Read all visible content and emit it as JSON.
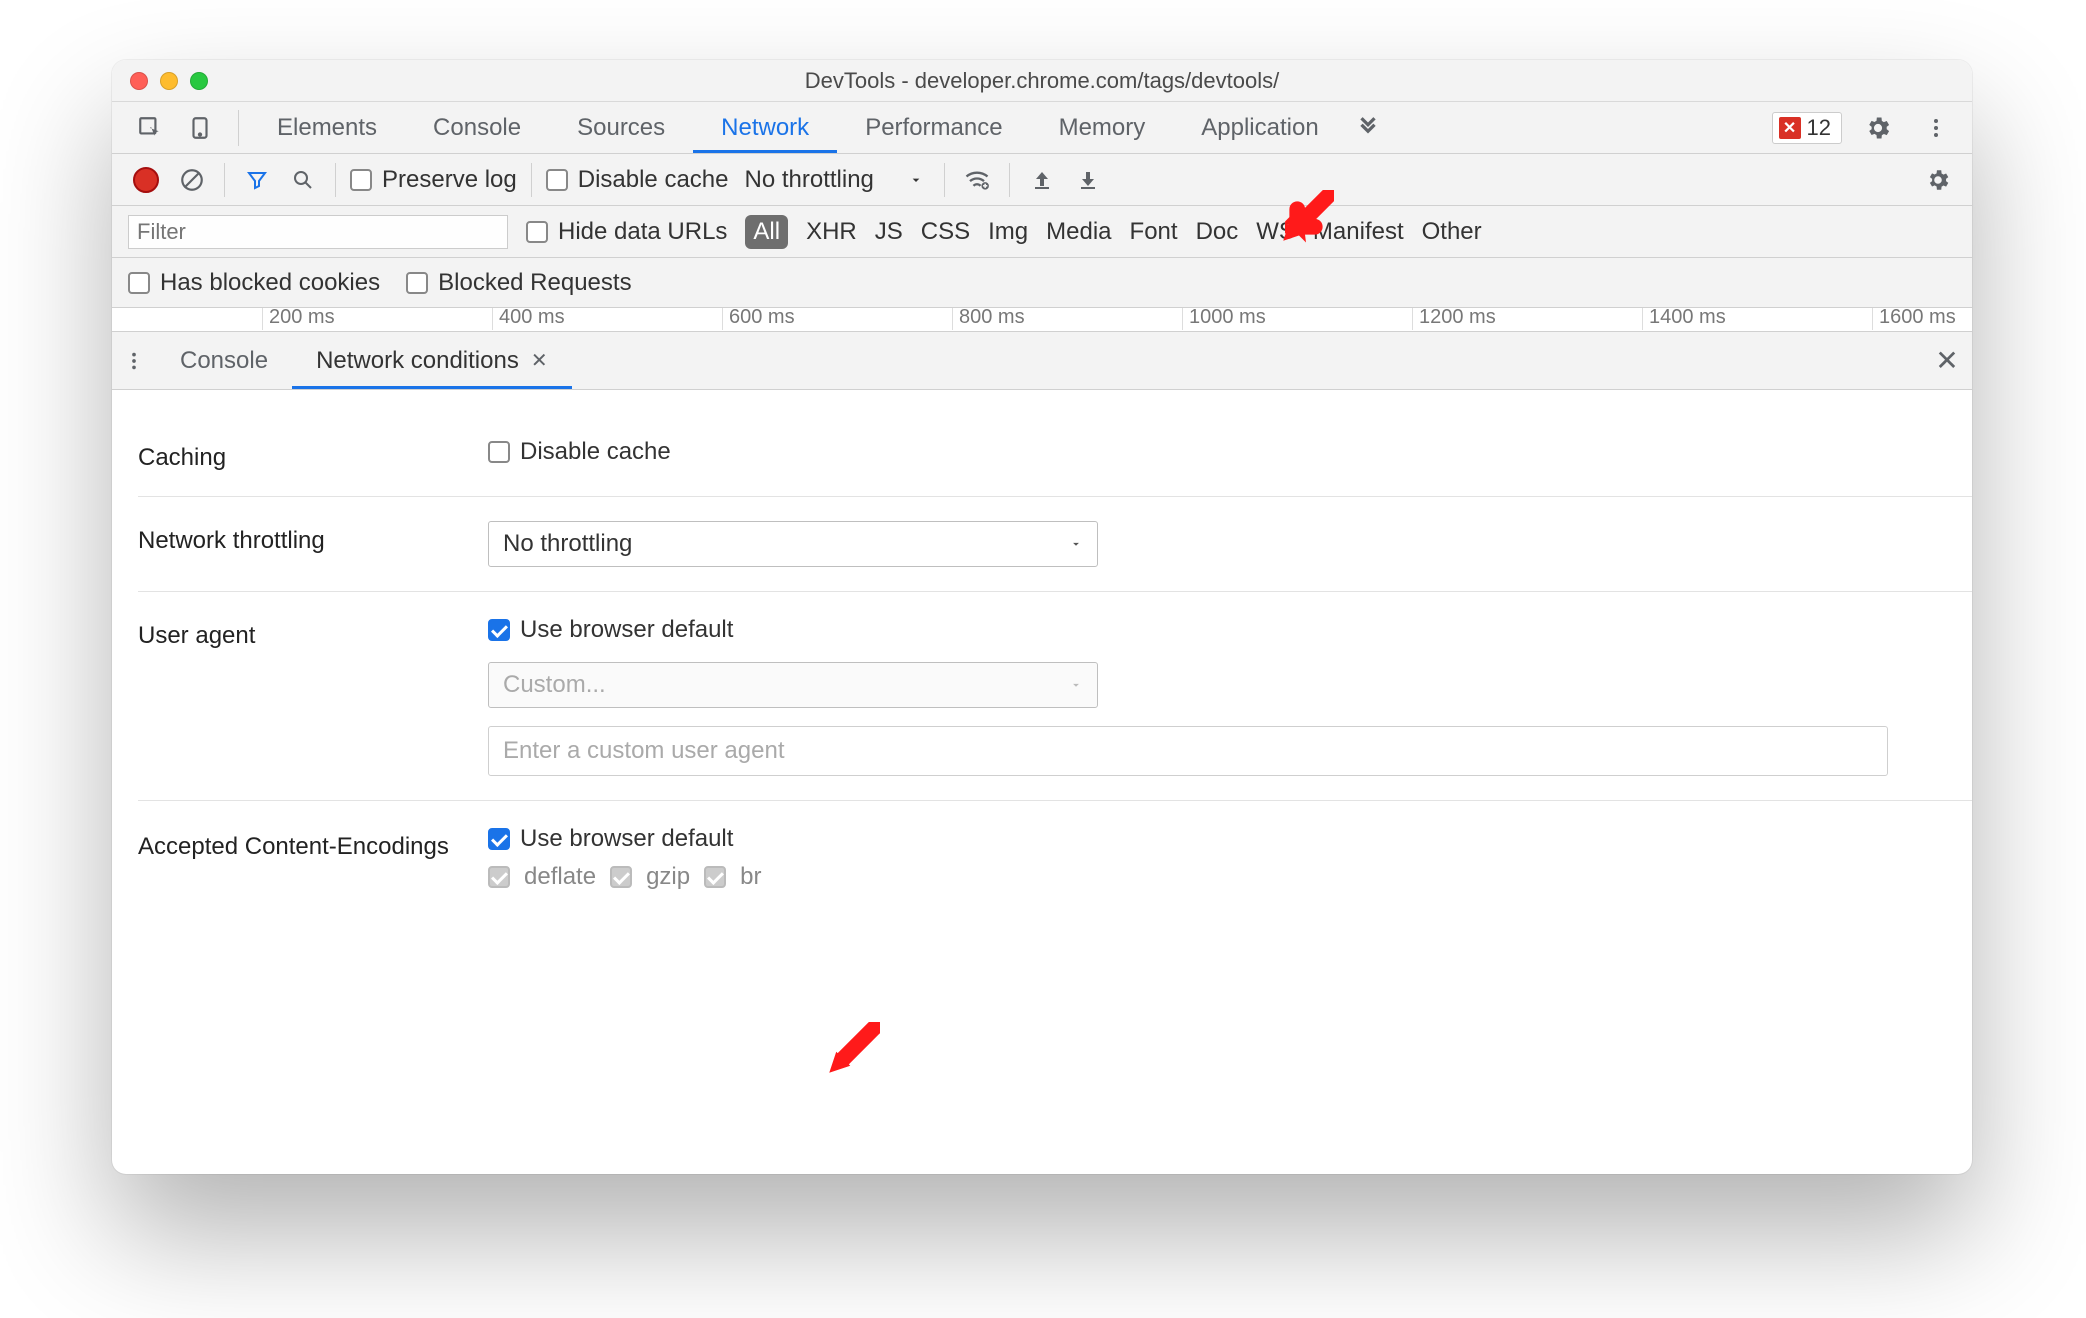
{
  "window": {
    "title": "DevTools - developer.chrome.com/tags/devtools/"
  },
  "mainTabs": {
    "items": [
      "Elements",
      "Console",
      "Sources",
      "Network",
      "Performance",
      "Memory",
      "Application"
    ],
    "activeIndex": 3
  },
  "errorBadge": {
    "count": "12",
    "icon_glyph": "✕"
  },
  "netToolbar": {
    "preserve_log": "Preserve log",
    "disable_cache": "Disable cache",
    "throttling": "No throttling"
  },
  "filterRow": {
    "placeholder": "Filter",
    "hide_data_urls": "Hide data URLs",
    "types": [
      "All",
      "XHR",
      "JS",
      "CSS",
      "Img",
      "Media",
      "Font",
      "Doc",
      "WS",
      "Manifest",
      "Other"
    ],
    "activeType": 0
  },
  "blockedRow": {
    "blocked_cookies": "Has blocked cookies",
    "blocked_requests": "Blocked Requests"
  },
  "timeline": {
    "ticks": [
      "200 ms",
      "400 ms",
      "600 ms",
      "800 ms",
      "1000 ms",
      "1200 ms",
      "1400 ms",
      "1600 ms"
    ]
  },
  "drawer": {
    "tabs": [
      {
        "label": "Console",
        "active": false
      },
      {
        "label": "Network conditions",
        "active": true
      }
    ]
  },
  "panel": {
    "caching": {
      "label": "Caching",
      "disable_cache": "Disable cache"
    },
    "throttling": {
      "label": "Network throttling",
      "value": "No throttling"
    },
    "ua": {
      "label": "User agent",
      "use_default": "Use browser default",
      "custom_placeholder": "Custom...",
      "input_placeholder": "Enter a custom user agent"
    },
    "encodings": {
      "label": "Accepted Content-Encodings",
      "use_default": "Use browser default",
      "options": [
        "deflate",
        "gzip",
        "br"
      ]
    }
  }
}
